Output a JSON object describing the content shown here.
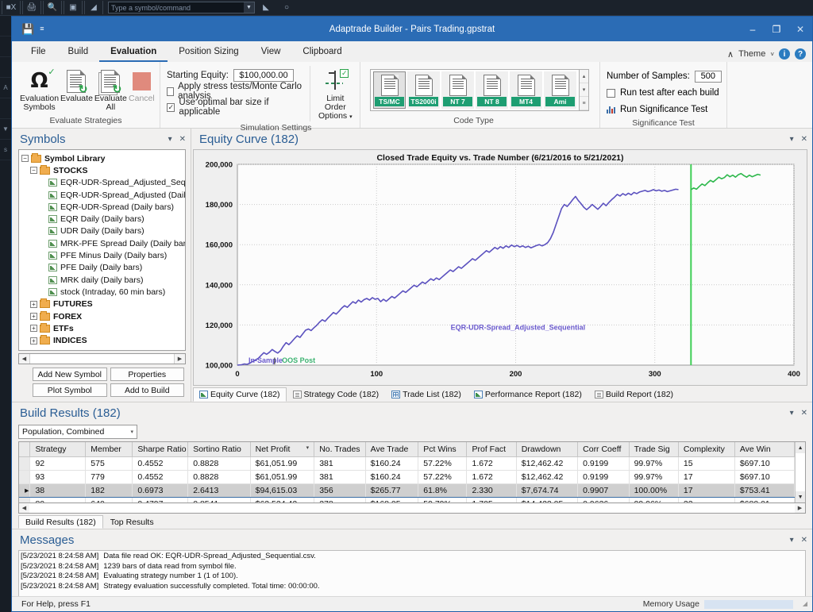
{
  "backdrop": {
    "toolbar_buttons": [
      "x-icon",
      "printer-icon",
      "magnifier-icon",
      "window-icon",
      "cursor-icon"
    ],
    "combo_placeholder": "Type a symbol/command",
    "side_labels": [
      "A",
      "A",
      "▼",
      "s"
    ]
  },
  "titlebar": {
    "title": "Adaptrade Builder - Pairs Trading.gpstrat",
    "qat": [
      "save-icon",
      "overflow-icon"
    ],
    "minimize": "–",
    "maximize": "❐",
    "close": "✕"
  },
  "ribbon": {
    "tabs": [
      {
        "label": "File",
        "active": false
      },
      {
        "label": "Build",
        "active": false
      },
      {
        "label": "Evaluation",
        "active": true
      },
      {
        "label": "Position Sizing",
        "active": false
      },
      {
        "label": "View",
        "active": false
      },
      {
        "label": "Clipboard",
        "active": false
      }
    ],
    "theme_label": "Theme",
    "collapse_caret": "∧",
    "theme_caret": "˅",
    "info_icon": "i",
    "help_icon": "?",
    "groups": {
      "evaluate_strategies": {
        "label": "Evaluate Strategies",
        "buttons": [
          {
            "name": "evaluation-symbols",
            "line1": "Evaluation",
            "line2": "Symbols",
            "disabled": false
          },
          {
            "name": "evaluate",
            "line1": "Evaluate",
            "line2": "",
            "disabled": false
          },
          {
            "name": "evaluate-all",
            "line1": "Evaluate",
            "line2": "All",
            "disabled": false
          },
          {
            "name": "cancel",
            "line1": "Cancel",
            "line2": "",
            "disabled": true
          }
        ]
      },
      "simulation_settings": {
        "label": "Simulation Settings",
        "starting_equity_label": "Starting Equity:",
        "starting_equity_value": "$100,000.00",
        "checkbox1_label": "Apply stress tests/Monte Carlo analysis",
        "checkbox1_checked": false,
        "checkbox2_label": "Use optimal bar size if applicable",
        "checkbox2_checked": true,
        "limit_order_line1": "Limit Order",
        "limit_order_line2": "Options",
        "limit_order_caret": "▾"
      },
      "code_type": {
        "label": "Code Type",
        "items": [
          {
            "tag": "TS/MC",
            "selected": true
          },
          {
            "tag": "TS2000i",
            "selected": false
          },
          {
            "tag": "NT 7",
            "selected": false
          },
          {
            "tag": "NT 8",
            "selected": false
          },
          {
            "tag": "MT4",
            "selected": false
          },
          {
            "tag": "Ami",
            "selected": false
          }
        ],
        "scroll_up": "▴",
        "scroll_down": "▾",
        "scroll_more": "≡"
      },
      "significance_test": {
        "label": "Significance Test",
        "samples_label": "Number of Samples:",
        "samples_value": "500",
        "checkbox_label": "Run test after each build",
        "checkbox_checked": false,
        "run_label": "Run Significance Test"
      }
    }
  },
  "symbols_panel": {
    "title": "Symbols",
    "caret": "▾",
    "close": "✕",
    "tree": [
      {
        "depth": 0,
        "type": "folder",
        "toggle": "−",
        "label": "Symbol Library",
        "bold": true
      },
      {
        "depth": 1,
        "type": "folder",
        "toggle": "−",
        "label": "STOCKS",
        "bold": true
      },
      {
        "depth": 2,
        "type": "leaf",
        "label": "EQR-UDR-Spread_Adjusted_Sequen"
      },
      {
        "depth": 2,
        "type": "leaf",
        "label": "EQR-UDR-Spread_Adjusted (Daily b"
      },
      {
        "depth": 2,
        "type": "leaf",
        "label": "EQR-UDR-Spread (Daily bars)"
      },
      {
        "depth": 2,
        "type": "leaf",
        "label": "EQR Daily (Daily bars)"
      },
      {
        "depth": 2,
        "type": "leaf",
        "label": "UDR Daily (Daily bars)"
      },
      {
        "depth": 2,
        "type": "leaf",
        "label": "MRK-PFE Spread Daily (Daily bars)"
      },
      {
        "depth": 2,
        "type": "leaf",
        "label": "PFE Minus Daily (Daily bars)"
      },
      {
        "depth": 2,
        "type": "leaf",
        "label": "PFE Daily (Daily bars)"
      },
      {
        "depth": 2,
        "type": "leaf",
        "label": "MRK daily (Daily bars)"
      },
      {
        "depth": 2,
        "type": "leaf",
        "label": "stock (Intraday, 60 min bars)"
      },
      {
        "depth": 1,
        "type": "folder",
        "toggle": "+",
        "label": "FUTURES",
        "bold": true
      },
      {
        "depth": 1,
        "type": "folder",
        "toggle": "+",
        "label": "FOREX",
        "bold": true
      },
      {
        "depth": 1,
        "type": "folder",
        "toggle": "+",
        "label": "ETFs",
        "bold": true
      },
      {
        "depth": 1,
        "type": "folder",
        "toggle": "+",
        "label": "INDICES",
        "bold": true
      }
    ],
    "buttons": [
      "Add New Symbol",
      "Properties",
      "Plot Symbol",
      "Add to Build"
    ]
  },
  "equity_panel": {
    "title": "Equity Curve (182)",
    "caret": "▾",
    "close": "✕",
    "tabs": [
      {
        "label": "Equity Curve (182)",
        "icon": "chart-icon",
        "active": true
      },
      {
        "label": "Strategy Code (182)",
        "icon": "document-icon",
        "active": false
      },
      {
        "label": "Trade List (182)",
        "icon": "grid-icon",
        "active": false
      },
      {
        "label": "Performance Report (182)",
        "icon": "report-icon",
        "active": false
      },
      {
        "label": "Build Report (182)",
        "icon": "report-icon",
        "active": false
      }
    ]
  },
  "chart_data": {
    "type": "line",
    "title": "Closed Trade Equity vs. Trade Number (6/21/2016 to 5/21/2021)",
    "xlabel": "",
    "ylabel": "",
    "xlim": [
      0,
      400
    ],
    "ylim": [
      100000,
      200000
    ],
    "xticks": [
      0,
      100,
      200,
      300,
      400
    ],
    "yticks": [
      100000,
      120000,
      140000,
      160000,
      180000,
      200000
    ],
    "ytick_labels": [
      "100,000",
      "120,000",
      "140,000",
      "160,000",
      "180,000",
      "200,000"
    ],
    "grid": true,
    "annotations": [
      {
        "text": "In-Sample",
        "color": "#6a5acd",
        "x": 8,
        "y": 101200
      },
      {
        "text": "|",
        "color": "#333333",
        "x": 26,
        "y": 101200
      },
      {
        "text": "OOS Post",
        "color": "#3cb371",
        "x": 32,
        "y": 101200
      },
      {
        "text": "EQR-UDR-Spread_Adjusted_Sequential",
        "color": "#6a5acd",
        "x": 250,
        "y": 117500
      }
    ],
    "vertical_marker": {
      "x": 326,
      "color": "#3ece55",
      "label": "OOS divider"
    },
    "series": [
      {
        "name": "In-Sample",
        "color": "#5b51bf",
        "x": [
          0,
          3,
          5,
          7,
          9,
          11,
          13,
          15,
          17,
          19,
          21,
          23,
          25,
          27,
          29,
          31,
          33,
          35,
          37,
          39,
          41,
          43,
          45,
          47,
          49,
          51,
          53,
          55,
          57,
          59,
          61,
          63,
          65,
          67,
          69,
          71,
          73,
          75,
          77,
          79,
          81,
          83,
          85,
          87,
          89,
          91,
          93,
          95,
          97,
          99,
          101,
          103,
          105,
          107,
          109,
          111,
          113,
          115,
          117,
          119,
          121,
          123,
          125,
          127,
          129,
          131,
          133,
          135,
          137,
          139,
          141,
          143,
          145,
          147,
          149,
          151,
          153,
          155,
          157,
          159,
          161,
          163,
          165,
          167,
          169,
          171,
          173,
          175,
          177,
          179,
          181,
          183,
          185,
          187,
          189,
          191,
          193,
          195,
          197,
          199,
          201,
          203,
          205,
          207,
          209,
          211,
          213,
          215,
          217,
          219,
          221,
          223,
          225,
          227,
          229,
          231,
          233,
          235,
          237,
          239,
          241,
          243,
          245,
          247,
          249,
          251,
          253,
          255,
          257,
          259,
          261,
          263,
          265,
          267,
          269,
          271,
          273,
          275,
          277,
          279,
          281,
          283,
          285,
          287,
          289,
          291,
          293,
          295,
          297,
          299,
          301,
          303,
          305,
          307,
          309,
          311,
          313,
          315,
          317,
          319,
          321,
          323,
          325,
          326
        ],
        "y": [
          100000,
          100200,
          100600,
          100400,
          101000,
          101800,
          102600,
          103400,
          104800,
          106200,
          105400,
          106400,
          107800,
          106800,
          106000,
          107200,
          109400,
          111200,
          110200,
          111600,
          113200,
          114600,
          113800,
          115600,
          117400,
          118000,
          117200,
          118600,
          119800,
          121400,
          122600,
          121800,
          123400,
          124800,
          126200,
          125400,
          126800,
          128400,
          129600,
          128800,
          130200,
          131600,
          130800,
          132400,
          131400,
          132600,
          133200,
          132400,
          133600,
          132800,
          133200,
          131600,
          132800,
          131800,
          133000,
          134200,
          133400,
          134600,
          135800,
          137000,
          136200,
          137400,
          138600,
          139800,
          139000,
          140200,
          141400,
          140600,
          141800,
          143000,
          142200,
          143400,
          142600,
          143800,
          145000,
          146200,
          147400,
          146600,
          147800,
          149000,
          148200,
          149400,
          150600,
          151800,
          153000,
          152200,
          153400,
          154600,
          155800,
          157000,
          156200,
          157400,
          158600,
          157800,
          159000,
          158200,
          159400,
          158600,
          159800,
          159000,
          159600,
          158800,
          159400,
          158600,
          159200,
          158400,
          159000,
          159600,
          160000,
          159400,
          160000,
          161000,
          163000,
          166000,
          170000,
          174000,
          178000,
          180000,
          179000,
          180600,
          182400,
          184000,
          182000,
          180400,
          178600,
          177400,
          178600,
          180000,
          178800,
          177600,
          179000,
          180600,
          179400,
          181000,
          182400,
          183600,
          185000,
          184200,
          185400,
          184600,
          185600,
          184800,
          186000,
          185400,
          186200,
          186600,
          187000,
          186400,
          186800,
          187400,
          186800,
          187200,
          186600,
          187000,
          186400,
          186800,
          187200,
          187600,
          187400
        ]
      },
      {
        "name": "OOS Post",
        "color": "#2eb84c",
        "x": [
          326,
          328,
          330,
          332,
          334,
          336,
          338,
          340,
          342,
          344,
          346,
          348,
          350,
          352,
          354,
          356,
          358,
          360,
          362,
          364,
          366,
          368,
          370,
          372,
          374,
          376
        ],
        "y": [
          187400,
          188200,
          187600,
          189000,
          190200,
          189400,
          190800,
          192000,
          191200,
          192400,
          193600,
          192800,
          193400,
          194800,
          193800,
          194600,
          193600,
          194800,
          195400,
          194400,
          193600,
          194600,
          193800,
          194400,
          195000,
          194600
        ]
      }
    ]
  },
  "build_results": {
    "title": "Build Results (182)",
    "caret": "▾",
    "close": "✕",
    "filter_value": "Population, Combined",
    "filter_caret": "▾",
    "columns": [
      "Strategy",
      "Member",
      "Sharpe Ratio",
      "Sortino Ratio",
      "Net Profit",
      "No. Trades",
      "Ave Trade",
      "Pct Wins",
      "Prof Fact",
      "Drawdown",
      "Corr Coeff",
      "Trade Sig",
      "Complexity",
      "Ave Win"
    ],
    "sorted_column": "Net Profit",
    "sort_indicator": "▾",
    "rows": [
      {
        "selected": false,
        "marker": "",
        "cells": [
          "92",
          "575",
          "0.4552",
          "0.8828",
          "$61,051.99",
          "381",
          "$160.24",
          "57.22%",
          "1.672",
          "$12,462.42",
          "0.9199",
          "99.97%",
          "15",
          "$697.10"
        ]
      },
      {
        "selected": false,
        "marker": "",
        "cells": [
          "93",
          "779",
          "0.4552",
          "0.8828",
          "$61,051.99",
          "381",
          "$160.24",
          "57.22%",
          "1.672",
          "$12,462.42",
          "0.9199",
          "99.97%",
          "17",
          "$697.10"
        ]
      },
      {
        "selected": true,
        "marker": "▸",
        "cells": [
          "38",
          "182",
          "0.6973",
          "2.6413",
          "$94,615.03",
          "356",
          "$265.77",
          "61.8%",
          "2.330",
          "$7,674.74",
          "0.9907",
          "100.00%",
          "17",
          "$753.41"
        ]
      },
      {
        "selected": false,
        "marker": "",
        "cells": [
          "80",
          "640",
          "0.4797",
          "0.8541",
          "$63,524.42",
          "378",
          "$168.05",
          "59.79%",
          "1.705",
          "$14,422.05",
          "0.9636",
          "99.96%",
          "22",
          "$680.01"
        ]
      }
    ],
    "tabs": [
      {
        "label": "Build Results (182)",
        "active": true
      },
      {
        "label": "Top Results",
        "active": false
      }
    ]
  },
  "messages_panel": {
    "title": "Messages",
    "caret": "▾",
    "close": "✕",
    "lines": [
      {
        "timestamp": "[5/23/2021 8:24:58 AM]",
        "text": "Data file read OK: EQR-UDR-Spread_Adjusted_Sequential.csv."
      },
      {
        "timestamp": "[5/23/2021 8:24:58 AM]",
        "text": "1239 bars of data read from symbol file."
      },
      {
        "timestamp": "[5/23/2021 8:24:58 AM]",
        "text": "Evaluating strategy number 1 (1 of 100)."
      },
      {
        "timestamp": "[5/23/2021 8:24:58 AM]",
        "text": "Strategy evaluation successfully completed. Total time: 00:00:00."
      }
    ]
  },
  "statusbar": {
    "help_text": "For Help, press F1",
    "memory_label": "Memory Usage",
    "memory_percent": 32
  },
  "colors": {
    "accent": "#2b6cb5",
    "panel_title": "#2a5d94",
    "in_sample_line": "#5b51bf",
    "oos_line": "#2eb84c",
    "marker_line": "#3ece55",
    "code_tag": "#1e9e72"
  }
}
